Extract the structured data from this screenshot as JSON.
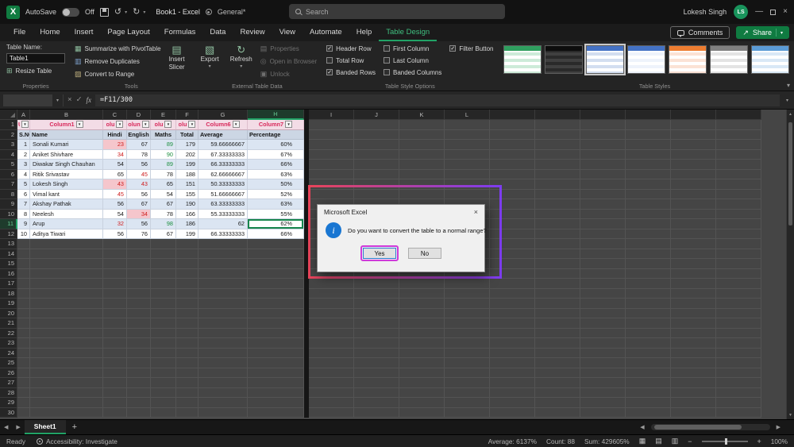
{
  "titlebar": {
    "autosave_label": "AutoSave",
    "autosave_state": "Off",
    "doc_title": "Book1 - Excel",
    "sensitivity_label": "General*",
    "search_placeholder": "Search",
    "user_name": "Lokesh Singh",
    "user_initials": "LS"
  },
  "tabs": {
    "items": [
      "File",
      "Home",
      "Insert",
      "Page Layout",
      "Formulas",
      "Data",
      "Review",
      "View",
      "Automate",
      "Help",
      "Table Design"
    ],
    "active": "Table Design",
    "comments_label": "Comments",
    "share_label": "Share"
  },
  "ribbon": {
    "properties_group": {
      "table_name_label": "Table Name:",
      "table_name_value": "Table1",
      "resize_button": "Resize Table",
      "group_label": "Properties"
    },
    "tools_group": {
      "buttons": [
        "Summarize with PivotTable",
        "Remove Duplicates",
        "Convert to Range"
      ],
      "insert_slicer_line1": "Insert",
      "insert_slicer_line2": "Slicer",
      "group_label": "Tools"
    },
    "external_group": {
      "export_label": "Export",
      "refresh_label": "Refresh",
      "disabled_buttons": [
        "Properties",
        "Open in Browser",
        "Unlock"
      ],
      "group_label": "External Table Data"
    },
    "style_options_group": {
      "options": [
        {
          "label": "Header Row",
          "checked": true
        },
        {
          "label": "Total Row",
          "checked": false
        },
        {
          "label": "Banded Rows",
          "checked": true
        },
        {
          "label": "First Column",
          "checked": false
        },
        {
          "label": "Last Column",
          "checked": false
        },
        {
          "label": "Banded Columns",
          "checked": false
        },
        {
          "label": "Filter Button",
          "checked": true
        }
      ],
      "group_label": "Table Style Options"
    },
    "styles_group": {
      "group_label": "Table Styles",
      "styles": [
        {
          "name": "table-style-green",
          "header": "#2f9e5f",
          "band": "#cdebd9",
          "base": "#ffffff",
          "selected": false
        },
        {
          "name": "table-style-black",
          "header": "#0d0d0d",
          "band": "#404040",
          "base": "#2a2a2a",
          "selected": false
        },
        {
          "name": "table-style-blue-medium",
          "header": "#4472c4",
          "band": "#d3def0",
          "base": "#ffffff",
          "selected": true
        },
        {
          "name": "table-style-blue-grid",
          "header": "#4472c4",
          "band": "#eef3fb",
          "base": "#ffffff",
          "selected": false
        },
        {
          "name": "table-style-orange",
          "header": "#ed7d31",
          "band": "#fbe2d5",
          "base": "#ffffff",
          "selected": false
        },
        {
          "name": "table-style-gray",
          "header": "#808080",
          "band": "#e3e3e3",
          "base": "#ffffff",
          "selected": false
        },
        {
          "name": "table-style-light-blue",
          "header": "#5b9bd5",
          "band": "#d9e8f6",
          "base": "#ffffff",
          "selected": false
        }
      ]
    }
  },
  "formula_bar": {
    "name_box": "",
    "fx_label": "fx",
    "formula": "=F11/300"
  },
  "sheet": {
    "col_letters": [
      "A",
      "B",
      "C",
      "D",
      "E",
      "F",
      "G",
      "H"
    ],
    "col_letters_right": [
      "I",
      "J",
      "K",
      "L"
    ],
    "row_count": 30,
    "table": {
      "header_labels": [
        "UD",
        "Column1",
        "olu",
        "olun",
        "olu",
        "olu",
        "Column6",
        "Column7"
      ],
      "subheader": [
        "S.NO",
        "Name",
        "Hindi",
        "English",
        "Maths",
        "Total",
        "Average",
        "Percentage"
      ],
      "rows": [
        [
          "1",
          "Sonali Kumari",
          "23",
          "67",
          "89",
          "179",
          "59.66666667",
          "60%"
        ],
        [
          "2",
          "Aniket Shivhare",
          "34",
          "78",
          "90",
          "202",
          "67.33333333",
          "67%"
        ],
        [
          "3",
          "Diwakar Singh Chauhan",
          "54",
          "56",
          "89",
          "199",
          "66.33333333",
          "66%"
        ],
        [
          "4",
          "Ritik Srivastav",
          "65",
          "45",
          "78",
          "188",
          "62.66666667",
          "63%"
        ],
        [
          "5",
          "Lokesh Singh",
          "43",
          "43",
          "65",
          "151",
          "50.33333333",
          "50%"
        ],
        [
          "6",
          "Vimal kant",
          "45",
          "56",
          "54",
          "155",
          "51.66666667",
          "52%"
        ],
        [
          "7",
          "Akshay Pathak",
          "56",
          "67",
          "67",
          "190",
          "63.33333333",
          "63%"
        ],
        [
          "8",
          "Neelesh",
          "54",
          "34",
          "78",
          "166",
          "55.33333333",
          "55%"
        ],
        [
          "9",
          "Arup",
          "32",
          "56",
          "98",
          "186",
          "62",
          "62%"
        ],
        [
          "10",
          "Aditya Tiwari",
          "56",
          "76",
          "67",
          "199",
          "66.33333333",
          "66%"
        ]
      ],
      "red_text_cells": [
        "C3",
        "C4",
        "C7",
        "D7",
        "D6",
        "C8",
        "C11",
        "D10"
      ],
      "green_text_cells": [
        "E3",
        "E4",
        "E5",
        "E11"
      ],
      "pink_fill_cells": [
        "C3",
        "C7",
        "D10"
      ],
      "active_cell": "H11",
      "active_cell_value": "62%"
    }
  },
  "sheet_tabs": {
    "active_tab": "Sheet1"
  },
  "status_bar": {
    "mode": "Ready",
    "accessibility": "Accessibility: Investigate",
    "average": "Average: 6137%",
    "count": "Count: 88",
    "sum": "Sum: 429605%",
    "zoom": "100%"
  },
  "dialog": {
    "title": "Microsoft Excel",
    "message": "Do you want to convert the table to a normal range?",
    "yes_label": "Yes",
    "no_label": "No"
  },
  "colors": {
    "accent_green": "#21a366",
    "share_green": "#0f7b41",
    "annotation_red": "#e8445a",
    "annotation_purple": "#7d3cf0",
    "yes_highlight": "#cf3ad9",
    "band_blue": "#dbe5f2",
    "header_pink_bg": "#f3dce6",
    "header_pink_text": "#d8295b"
  },
  "icons": {
    "dropdown": "▾",
    "dropup": "▴",
    "close": "×",
    "check": "✓",
    "filter_dropdown": "▼",
    "undo": "↺",
    "redo": "↻",
    "pivot": "▦",
    "remove_duplicates": "▥",
    "convert_to_range": "▨",
    "slicer": "▤",
    "resize": "⊞",
    "export": "▧",
    "refresh": "↻",
    "properties": "▤",
    "open_browser": "◎",
    "unlock": "▣",
    "left": "◀",
    "right": "▶",
    "plus": "+",
    "minus": "−",
    "minimize": "—",
    "view_normal": "▦",
    "view_layout": "▤",
    "view_break": "▥",
    "share_arrow": "↗",
    "info": "i",
    "more": "▿"
  }
}
